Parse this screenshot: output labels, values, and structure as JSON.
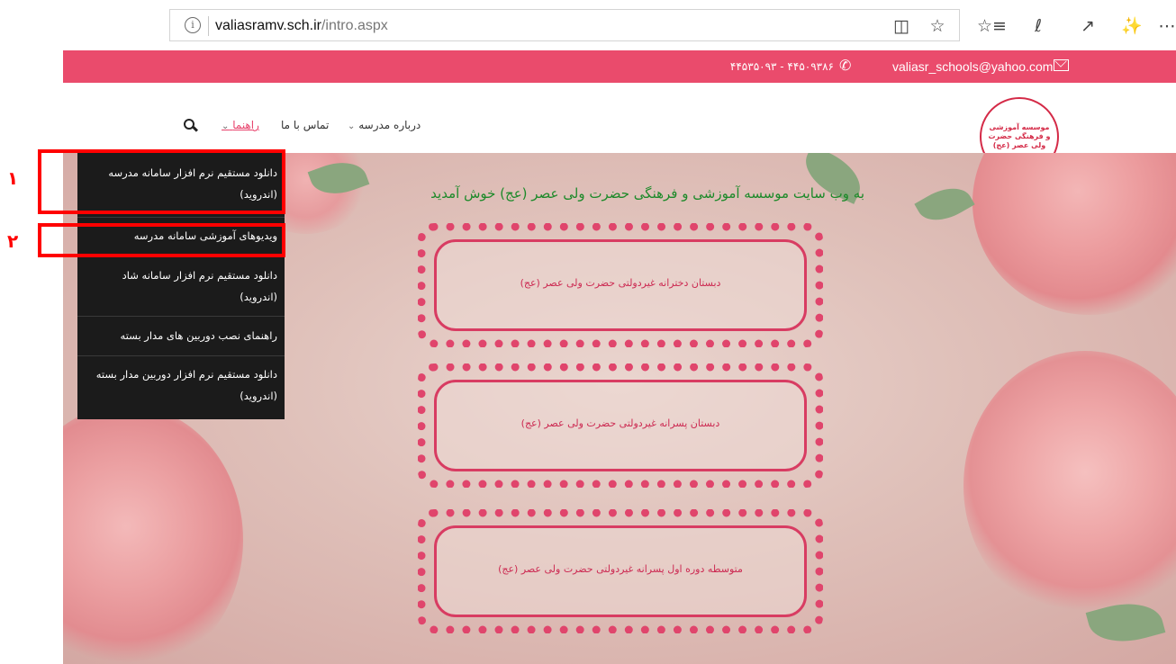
{
  "browser": {
    "url_host": "valiasramv.sch.ir",
    "url_path": "/intro.aspx",
    "icons": [
      "info-icon",
      "reading-view-icon",
      "star-icon",
      "favorites-list-icon",
      "pen-icon",
      "share-icon",
      "extension-icon",
      "more-icon"
    ]
  },
  "topbar": {
    "phones": "۴۴۵۳۵۰۹۳ - ۴۴۵۰۹۳۸۶",
    "email": "valiasr_schools@yahoo.com",
    "color": "#ea4b6c"
  },
  "nav": {
    "items": [
      {
        "label": "درباره مدرسه",
        "has_dropdown": true
      },
      {
        "label": "تماس با ما",
        "has_dropdown": false
      },
      {
        "label": "راهنما",
        "has_dropdown": true,
        "active": true
      }
    ]
  },
  "logo": {
    "text": "موسسه آموزشی و فرهنگی حضرت ولی عصر (عج)"
  },
  "hero": {
    "welcome": "به وب سایت موسسه آموزشی و فرهنگی حضرت ولی عصر (عج) خوش آمدید"
  },
  "schools": [
    {
      "label": "دبستان دخترانه غیردولتی حضرت ولی عصر (عج)"
    },
    {
      "label": "دبستان پسرانه غیردولتی حضرت ولی عصر (عج)"
    },
    {
      "label": "متوسطه دوره اول پسرانه غیردولتی حضرت ولی عصر (عج)"
    }
  ],
  "dropdown": {
    "items": [
      {
        "label": "دانلود مستقیم نرم افزار سامانه مدرسه (اندروید)"
      },
      {
        "label": "ویدیوهای آموزشی سامانه مدرسه"
      },
      {
        "label": "دانلود مستقیم نرم افزار سامانه شاد (اندروید)"
      },
      {
        "label": "راهنمای نصب دوربین های مدار بسته"
      },
      {
        "label": "دانلود مستقیم نرم افزار دوربین مدار بسته (اندروید)"
      }
    ]
  },
  "annotations": [
    {
      "number": "۱"
    },
    {
      "number": "۲"
    }
  ]
}
